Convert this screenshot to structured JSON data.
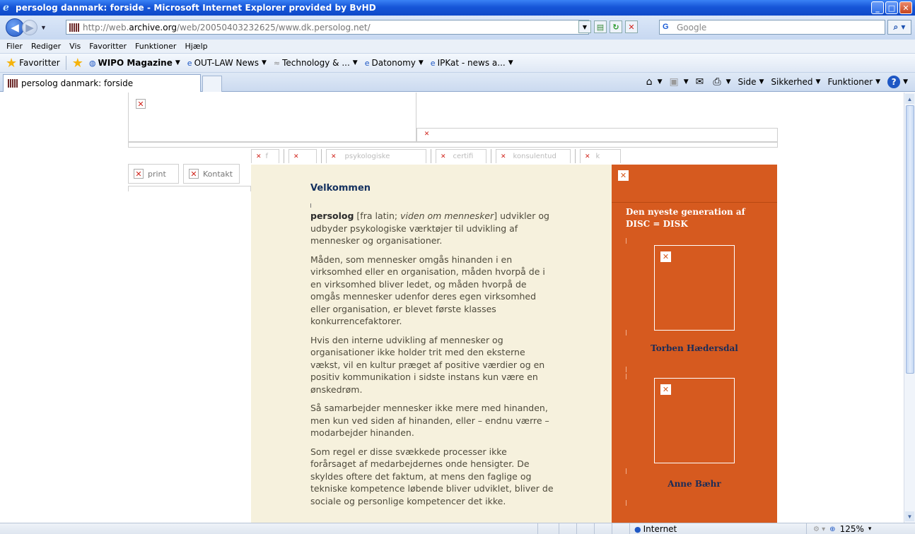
{
  "window": {
    "title": "persolog danmark: forside - Microsoft Internet Explorer provided by BvHD",
    "buttons": {
      "minimize": "_",
      "maximize": "□",
      "close": "✕"
    }
  },
  "addressbar": {
    "url_prefix": "http://web.",
    "url_domain": "archive.org",
    "url_rest": "/web/20050403232625/www.dk.persolog.net/",
    "search_placeholder": "Google"
  },
  "menu": {
    "items": [
      "Filer",
      "Rediger",
      "Vis",
      "Favoritter",
      "Funktioner",
      "Hjælp"
    ]
  },
  "favorites": {
    "label": "Favoritter",
    "links": [
      {
        "label": "WIPO Magazine",
        "bold": true,
        "icon": "wipo-icon"
      },
      {
        "label": "OUT-LAW News",
        "bold": false,
        "icon": "ie-page-icon"
      },
      {
        "label": "Technology & ...",
        "bold": false,
        "icon": "feed-icon"
      },
      {
        "label": "Datonomy",
        "bold": false,
        "icon": "ie-page-icon"
      },
      {
        "label": "IPKat - news a...",
        "bold": false,
        "icon": "ie-page-icon"
      }
    ]
  },
  "tabs": {
    "active_label": "persolog danmark: forside"
  },
  "commandbar": {
    "side": "Side",
    "sikkerhed": "Sikkerhed",
    "funktioner": "Funktioner"
  },
  "page": {
    "nav_cells": [
      "f",
      "",
      "psykologiske",
      "certifi",
      "konsulentud",
      "k"
    ],
    "buttons": {
      "print": "print",
      "kontakt": "Kontakt"
    },
    "welcome": "Velkommen",
    "intro": {
      "brand": "persolog",
      "before_italic": " [fra latin; ",
      "italic": "viden om mennesker",
      "after_italic": "] udvikler og udbyder psykologiske værktøjer til udvikling af mennesker og organisationer."
    },
    "paragraphs": [
      "Måden, som mennesker omgås hinanden i en virksomhed eller en organisation, måden hvorpå de i en virksomhed bliver ledet, og måden hvorpå de omgås mennesker udenfor deres egen virksomhed eller organisation, er blevet første klasses konkurrencefaktorer.",
      "Hvis den interne udvikling af mennesker og organisationer ikke holder trit med den eksterne vækst, vil en kultur præget af positive værdier og en positiv kommunikation i sidste instans kun være en ønskedrøm.",
      "Så samarbejder mennesker ikke mere med hinanden, men kun ved siden af hinanden, eller – endnu værre – modarbejder hinanden.",
      "Som regel er disse svækkede processer ikke forårsaget af medarbejdernes onde hensigter. De skyldes oftere det faktum, at mens den faglige og tekniske kompetence løbende bliver udviklet, bliver de sociale og personlige kompetencer det ikke."
    ],
    "sidebar": {
      "heading": "Den nyeste generation af DISC = DISK",
      "persons": [
        "Torben Hædersdal",
        "Anne Bæhr"
      ]
    }
  },
  "statusbar": {
    "zone": "Internet",
    "zoom": "125%"
  },
  "colors": {
    "titlebar": "#1656d8",
    "content_bg": "#f6f1dd",
    "sidebar_bg": "#d65a1f",
    "person_name": "#1b2c58",
    "welcome": "#14315f"
  }
}
